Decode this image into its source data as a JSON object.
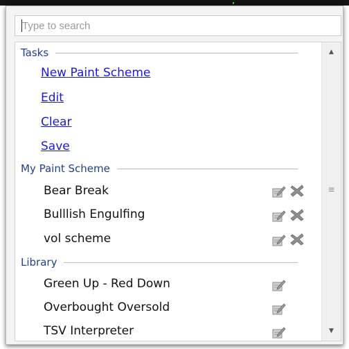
{
  "search": {
    "placeholder": "Type to search"
  },
  "sections": {
    "tasks": {
      "title": "Tasks",
      "links": [
        "New Paint Scheme",
        "Edit",
        "Clear",
        "Save"
      ]
    },
    "my_paint_scheme": {
      "title": "My Paint Scheme",
      "items": [
        "Bear Break",
        "Bulllish Engulfing",
        "vol scheme"
      ]
    },
    "library": {
      "title": "Library",
      "items": [
        "Green Up  - Red Down",
        "Overbought Oversold",
        "TSV Interpreter"
      ]
    }
  },
  "icons": {
    "edit": "edit-icon",
    "delete": "delete-icon",
    "scroll_up": "scroll-up-arrow-icon",
    "scroll_down": "scroll-down-arrow-icon",
    "grip": "scroll-grip-icon"
  },
  "colors": {
    "section_title": "#1f3f8f",
    "link": "#1a1ad8",
    "delete_x": "#8f8f8f",
    "edit_pad": "#a7a7a7"
  }
}
